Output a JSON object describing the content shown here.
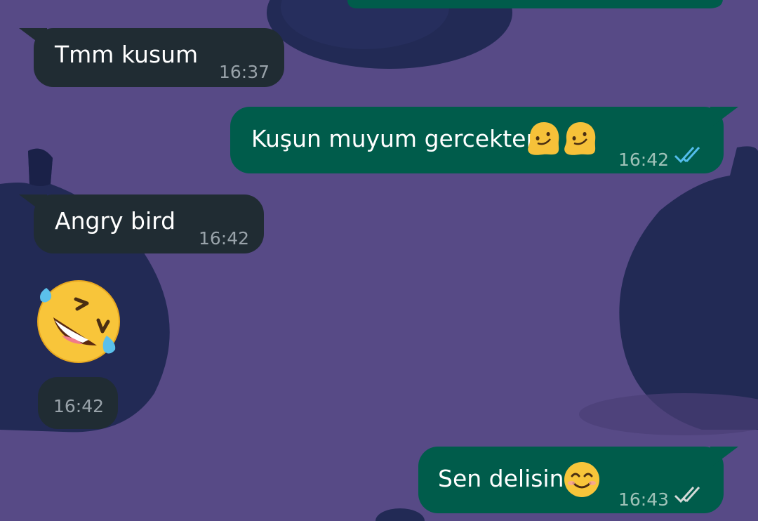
{
  "chat": {
    "messages": [
      {
        "direction": "incoming",
        "text": "Tmm kusum",
        "time": "16:37"
      },
      {
        "direction": "outgoing",
        "text": "Kuşun muyum gercekten",
        "emoji": "melting-face-emoji x2",
        "time": "16:42",
        "status": "read"
      },
      {
        "direction": "incoming",
        "text": "Angry bird",
        "time": "16:42"
      },
      {
        "direction": "incoming",
        "emoji": "rolling-on-the-floor-laughing-emoji",
        "time": "16:42"
      },
      {
        "direction": "outgoing",
        "text": "Sen delisin",
        "emoji": "smiling-face-emoji",
        "time": "16:43",
        "status": "delivered"
      }
    ]
  },
  "colors": {
    "wallpaper": "#574a86",
    "incoming_bubble": "#202c33",
    "outgoing_bubble": "#005c4b",
    "read_ticks": "#53bdeb",
    "delivered_ticks": "#d5dad8"
  }
}
